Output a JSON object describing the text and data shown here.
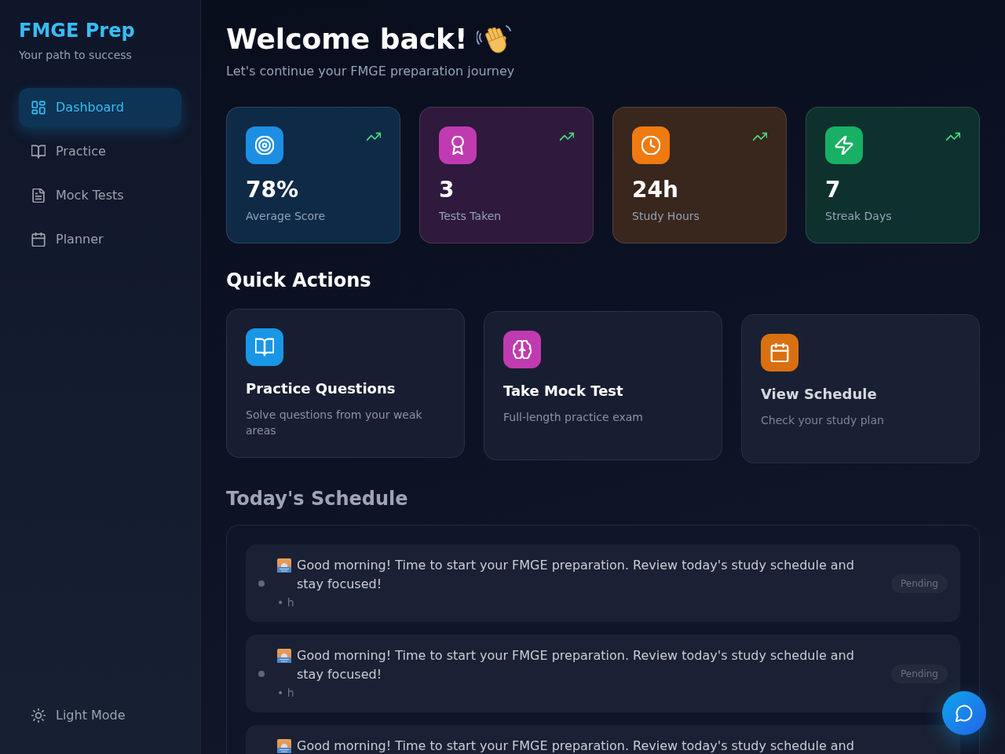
{
  "sidebar": {
    "brand": "FMGE Prep",
    "tagline": "Your path to success",
    "items": [
      {
        "label": "Dashboard",
        "selected": true
      },
      {
        "label": "Practice",
        "selected": false
      },
      {
        "label": "Mock Tests",
        "selected": false
      },
      {
        "label": "Planner",
        "selected": false
      }
    ],
    "theme_toggle": "Light Mode"
  },
  "header": {
    "title": "Welcome back!",
    "subtitle": "Let's continue your FMGE preparation journey"
  },
  "stats": [
    {
      "value": "78%",
      "label": "Average Score",
      "color": "#1d8fe3"
    },
    {
      "value": "3",
      "label": "Tests Taken",
      "color": "#c03bb0"
    },
    {
      "value": "24h",
      "label": "Study Hours",
      "color": "#ef7a10"
    },
    {
      "value": "7",
      "label": "Streak Days",
      "color": "#18b065"
    }
  ],
  "quick_actions": {
    "title": "Quick Actions",
    "items": [
      {
        "title": "Practice Questions",
        "description": "Solve questions from your weak areas",
        "color": "#1a96e6"
      },
      {
        "title": "Take Mock Test",
        "description": "Full-length practice exam",
        "color": "#c03bb0"
      },
      {
        "title": "View Schedule",
        "description": "Check your study plan",
        "color": "#d97010"
      }
    ]
  },
  "schedule": {
    "title": "Today's Schedule",
    "items": [
      {
        "text": "Good morning! Time to start your FMGE preparation. Review today's study schedule and stay focused!",
        "meta": "• h",
        "status": "Pending"
      },
      {
        "text": "Good morning! Time to start your FMGE preparation. Review today's study schedule and stay focused!",
        "meta": "• h",
        "status": "Pending"
      },
      {
        "text": "Good morning! Time to start your FMGE preparation. Review today's study schedule and"
      }
    ]
  }
}
